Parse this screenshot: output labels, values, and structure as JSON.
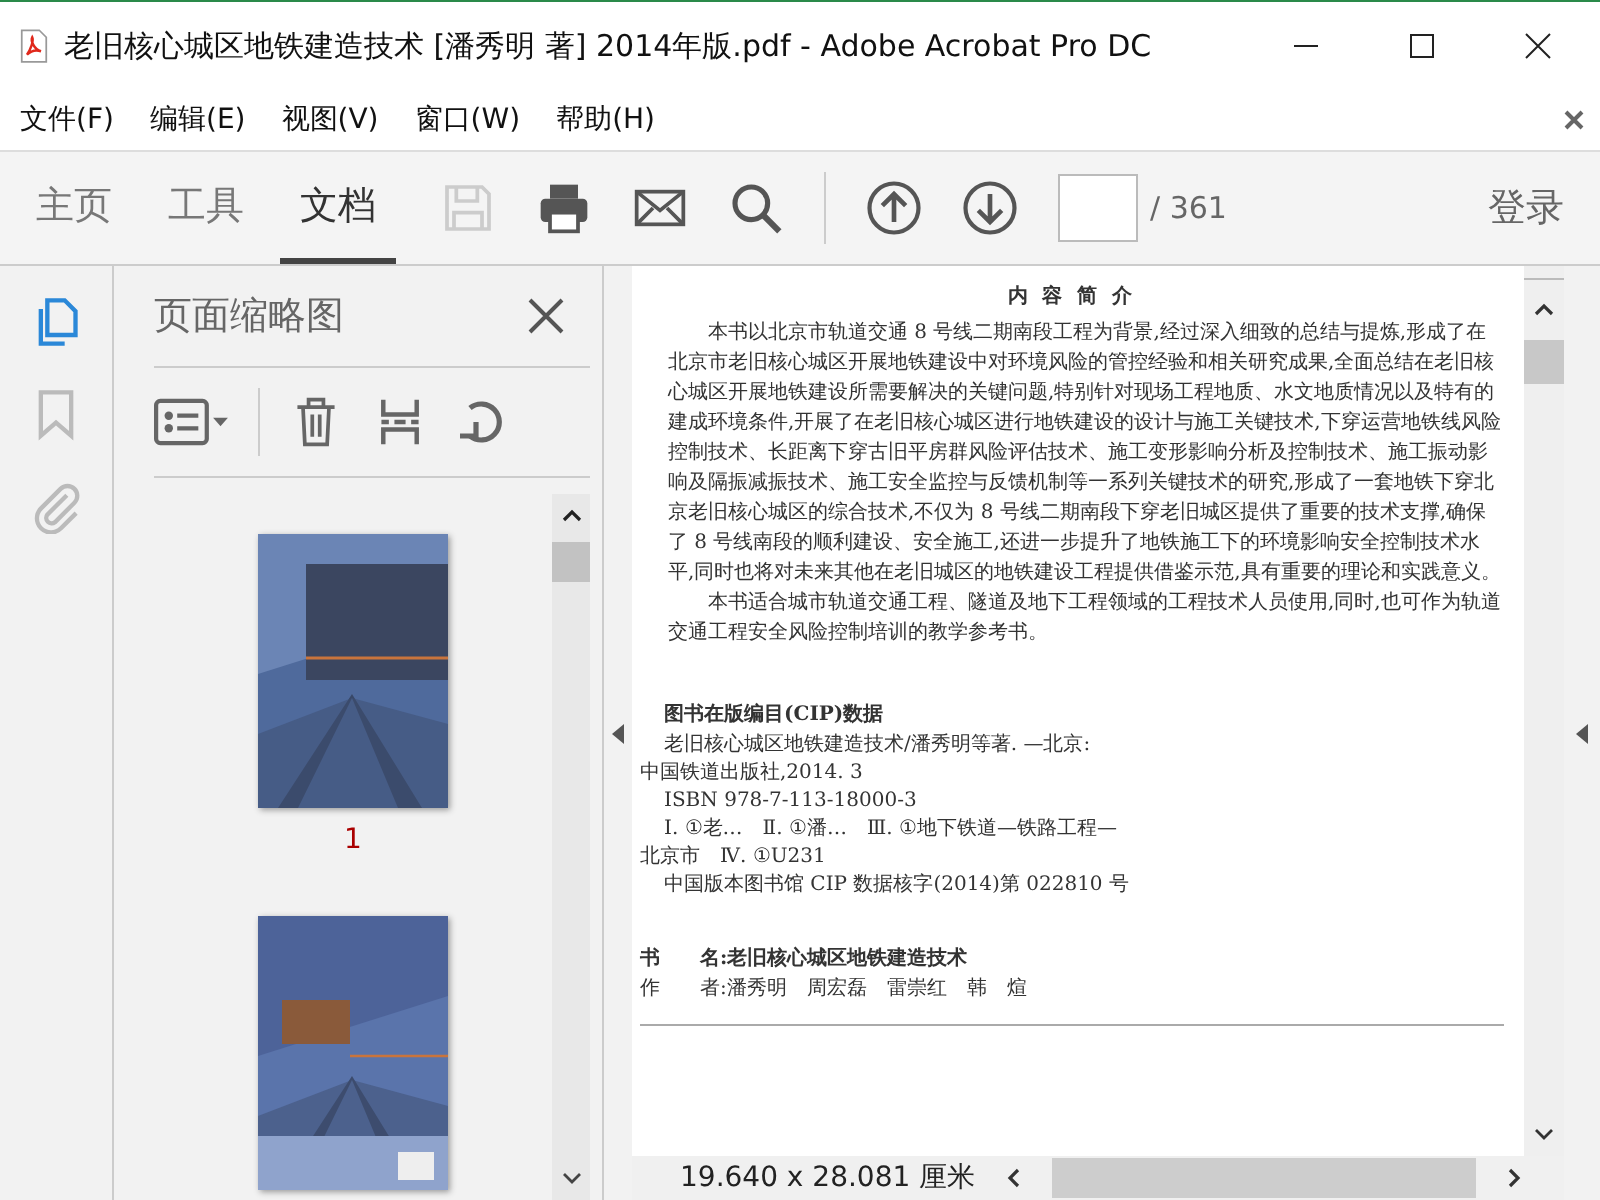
{
  "window": {
    "title": "老旧核心城区地铁建造技术 [潘秀明 著] 2014年版.pdf - Adobe Acrobat Pro DC"
  },
  "menu": [
    "文件(F)",
    "编辑(E)",
    "视图(V)",
    "窗口(W)",
    "帮助(H)"
  ],
  "tabs": [
    {
      "label": "主页",
      "selected": false
    },
    {
      "label": "工具",
      "selected": false
    },
    {
      "label": "文档",
      "selected": true
    }
  ],
  "tools": [
    {
      "kind": "save",
      "disabled": true
    },
    {
      "kind": "print",
      "disabled": false
    },
    {
      "kind": "mail",
      "disabled": false
    },
    {
      "kind": "search",
      "disabled": false
    }
  ],
  "page_nav": {
    "total": "/ 361"
  },
  "sign_in": "登录",
  "rail": [
    {
      "kind": "pages",
      "selected": true
    },
    {
      "kind": "bookmarks",
      "selected": false
    },
    {
      "kind": "attachments",
      "selected": false
    }
  ],
  "panel": {
    "title": "页面缩略图",
    "thumbnails": [
      {
        "kind": "picture",
        "label": "1"
      },
      {
        "kind": "picture"
      }
    ]
  },
  "document": {
    "heading": "内 容 简 介",
    "paragraphs": [
      "本书以北京市轨道交通 8 号线二期南段工程为背景,经过深入细致的总结与提炼,形成了在北京市老旧核心城区开展地铁建设中对环境风险的管控经验和相关研究成果,全面总结在老旧核心城区开展地铁建设所需要解决的关键问题,特别针对现场工程地质、水文地质情况以及特有的建成环境条件,开展了在老旧核心城区进行地铁建设的设计与施工关键技术,下穿运营地铁线风险控制技术、长距离下穿古旧平房群风险评估技术、施工变形影响分析及控制技术、施工振动影响及隔振减振技术、施工安全监控与反馈机制等一系列关键技术的研究,形成了一套地铁下穿北京老旧核心城区的综合技术,不仅为 8 号线二期南段下穿老旧城区提供了重要的技术支撑,确保了 8 号线南段的顺利建设、安全施工,还进一步提升了地铁施工下的环境影响安全控制技术水平,同时也将对未来其他在老旧城区的地铁建设工程提供借鉴示范,具有重要的理论和实践意义。",
      "本书适合城市轨道交通工程、隧道及地下工程领域的工程技术人员使用,同时,也可作为轨道交通工程安全风险控制培训的教学参考书。"
    ],
    "cip_title": "图书在版编目(CIP)数据",
    "cip_lines": [
      {
        "text": "老旧核心城区地铁建造技术/潘秀明等著. —北京:",
        "indented": true
      },
      {
        "text": "中国铁道出版社,2014. 3",
        "indented": false
      },
      {
        "text": "ISBN 978-7-113-18000-3",
        "indented": true
      },
      {
        "text": "Ⅰ. ①老…　Ⅱ. ①潘…　Ⅲ. ①地下铁道—铁路工程—",
        "indented": true
      },
      {
        "text": "北京市　Ⅳ. ①U231",
        "indented": false
      },
      {
        "text": "中国版本图书馆 CIP 数据核字(2014)第 022810 号",
        "indented": true
      }
    ],
    "credits": [
      {
        "text": "书　　名:老旧核心城区地铁建造技术",
        "bold": true
      },
      {
        "text": "作　　者:潘秀明　周宏磊　雷崇红　韩　煊",
        "bold": false
      }
    ]
  },
  "status_bar": {
    "page_size": "19.640 x 28.081 厘米"
  }
}
